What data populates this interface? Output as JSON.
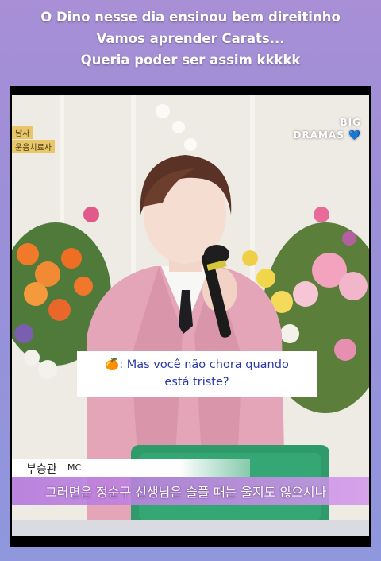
{
  "caption": {
    "line1": "O Dino nesse dia ensinou bem direitinho",
    "line2": "Vamos aprender Carats...",
    "line3": "Queria poder ser assim kkkkk"
  },
  "video": {
    "corner_tag1": "남자",
    "corner_tag2": "운음치료사",
    "watermark_line1": "BIG",
    "watermark_line2": "DRAMAS",
    "watermark_emoji": "💙",
    "subtitle_emoji": "🍊",
    "subtitle_line1": ": Mas você não chora quando",
    "subtitle_line2": "está triste?",
    "mc_name": "부승관",
    "mc_role": "MC",
    "korean_caption": "그러면은 정순구 선생님은 슬플 때는 울지도 않으시나"
  },
  "colors": {
    "background": "#9a8fd8",
    "subtitle_text": "#2a39a5",
    "jacket": "#e3a5b7"
  }
}
